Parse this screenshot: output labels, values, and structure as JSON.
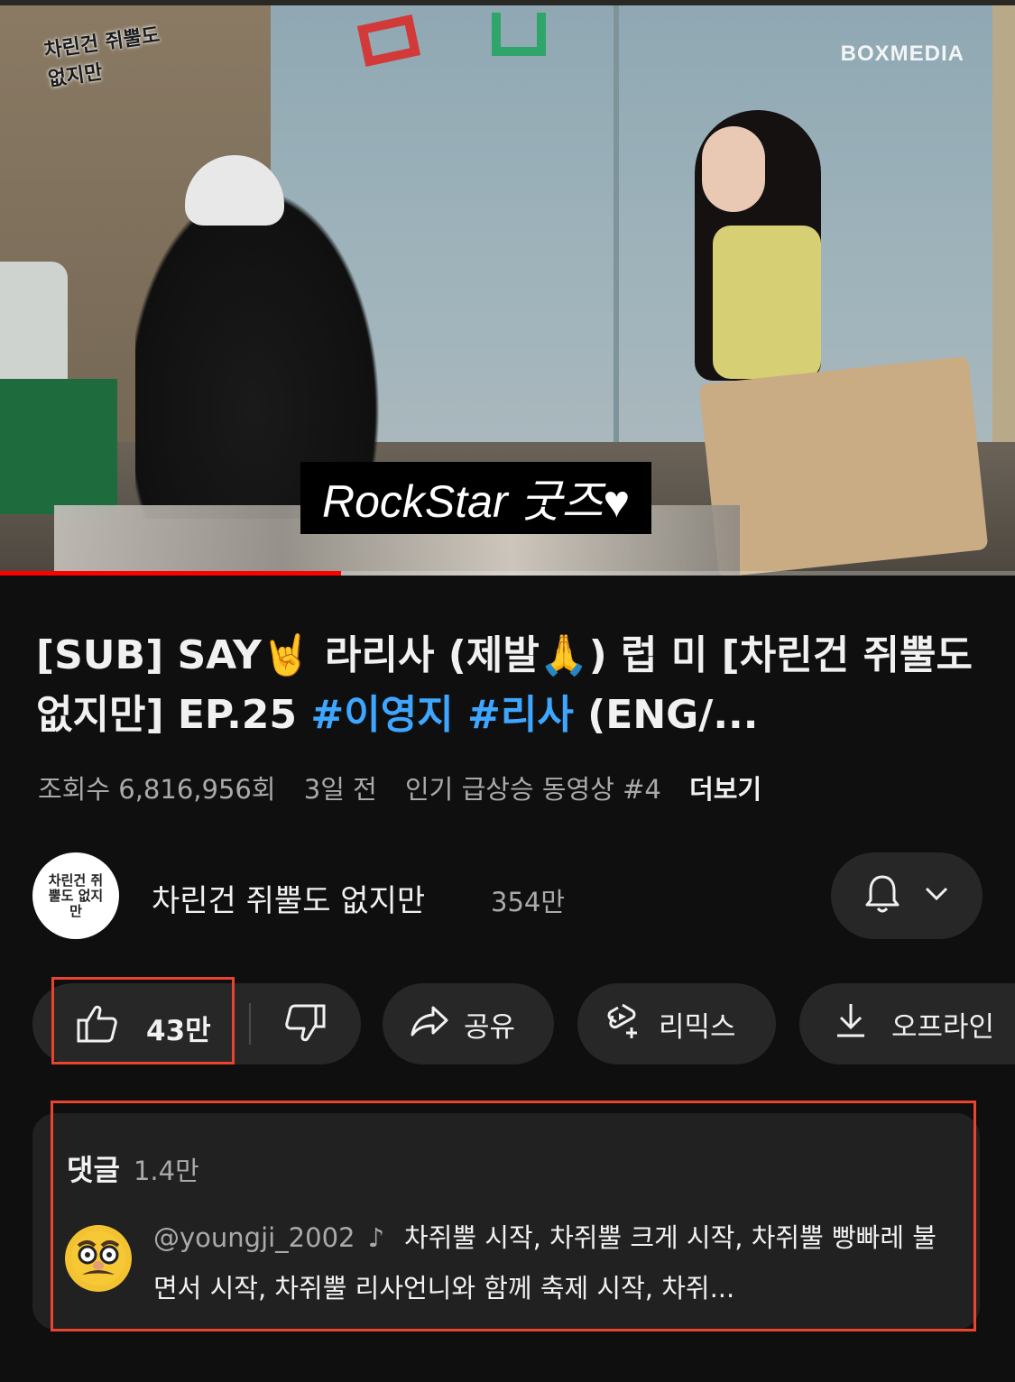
{
  "player": {
    "channel_logo_text": "차린건 쥐뿔도 없지만",
    "watermark": "BOXMEDIA",
    "subtitle": "RockStar 굿즈♥",
    "progress": 0.336
  },
  "video": {
    "title_main": "[SUB]  SAY🤘 라리사 (제발🙏) 럽 미  [차린건 쥐뿔도 없지만] EP.25 ",
    "tag1": "#이영지",
    "tag2": "#리사",
    "title_end": "  (ENG/...",
    "views": "조회수 6,816,956회",
    "age": "3일 전",
    "trending": "인기 급상승 동영상 #4",
    "more": "더보기"
  },
  "channel": {
    "name": "차린건 쥐뿔도 없지만",
    "subscribers": "354만",
    "avatar_text": "차린건 쥐뿔도 없지만"
  },
  "actions": {
    "like_count": "43만",
    "share": "공유",
    "remix": "리믹스",
    "offline": "오프라인"
  },
  "comments": {
    "label": "댓글",
    "count": "1.4만",
    "top": {
      "author": "@youngji_2002",
      "text": "차쥐뿔 시작, 차쥐뿔 크게 시작, 차쥐뿔 빵빠레 불면서 시작, 차쥐뿔 리사언니와 함께 축제 시작, 차쥐..."
    }
  },
  "colors": {
    "background": "#0f0f0f",
    "pill": "#272727",
    "hashtag": "#3ea6ff",
    "progress": "#ff0000",
    "highlight": "#e8442e"
  }
}
